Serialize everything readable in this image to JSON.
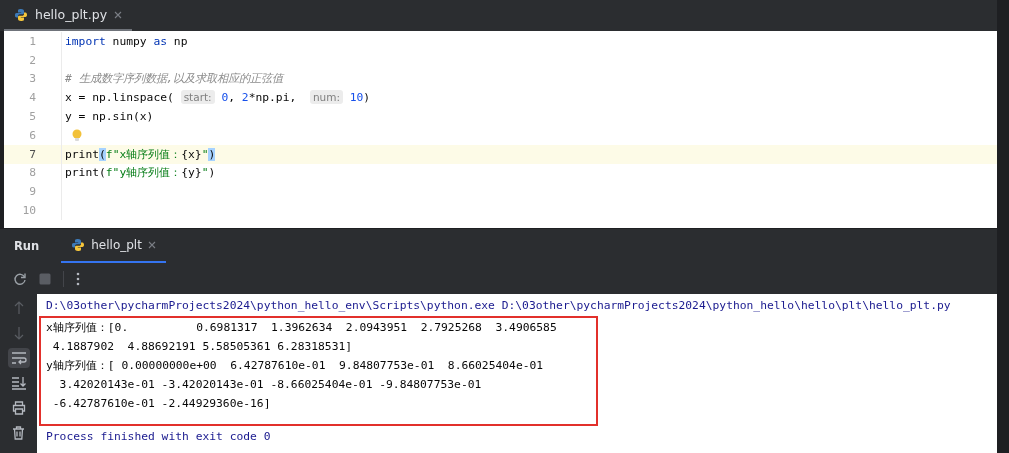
{
  "editor_tab": {
    "label": "hello_plt.py",
    "selected": true
  },
  "code_lines": [
    {
      "number": "1",
      "current": false,
      "bulb": false,
      "tokens": [
        {
          "kind": "keyword",
          "text": "import"
        },
        {
          "kind": "plain",
          "text": " numpy "
        },
        {
          "kind": "keyword",
          "text": "as"
        },
        {
          "kind": "plain",
          "text": " np"
        }
      ]
    },
    {
      "number": "2",
      "current": false,
      "bulb": false
    },
    {
      "number": "3",
      "current": false,
      "bulb": false,
      "tokens": [
        {
          "kind": "comment",
          "text": "# 生成数字序列数据,以及求取相应的正弦值"
        }
      ]
    },
    {
      "number": "4",
      "current": false,
      "bulb": false,
      "tokens": [
        {
          "kind": "plain",
          "text": "x = np.linspace( "
        },
        {
          "kind": "hint",
          "text": "start:"
        },
        {
          "kind": "number",
          "text": " 0"
        },
        {
          "kind": "plain",
          "text": ", "
        },
        {
          "kind": "number",
          "text": "2"
        },
        {
          "kind": "plain",
          "text": "*np.pi,  "
        },
        {
          "kind": "hint",
          "text": "num:"
        },
        {
          "kind": "number",
          "text": " 10"
        },
        {
          "kind": "plain",
          "text": ")"
        }
      ]
    },
    {
      "number": "5",
      "current": false,
      "bulb": false,
      "tokens": [
        {
          "kind": "plain",
          "text": "y = np.sin(x)"
        }
      ]
    },
    {
      "number": "6",
      "current": false,
      "bulb": true
    },
    {
      "number": "7",
      "current": true,
      "bulb": false,
      "tokens": [
        {
          "kind": "plain",
          "text": "print"
        },
        {
          "kind": "bracket-match",
          "text": "("
        },
        {
          "kind": "string",
          "text": "f\"x轴序列值："
        },
        {
          "kind": "plain",
          "text": "{x}"
        },
        {
          "kind": "string",
          "text": "\""
        },
        {
          "kind": "bracket-match",
          "text": ")"
        }
      ]
    },
    {
      "number": "8",
      "current": false,
      "bulb": false,
      "tokens": [
        {
          "kind": "plain",
          "text": "print("
        },
        {
          "kind": "string",
          "text": "f\"y轴序列值："
        },
        {
          "kind": "plain",
          "text": "{y}"
        },
        {
          "kind": "string",
          "text": "\""
        },
        {
          "kind": "plain",
          "text": ")"
        }
      ]
    },
    {
      "number": "9",
      "current": false,
      "bulb": false
    },
    {
      "number": "10",
      "current": false,
      "bulb": false
    }
  ],
  "run_panel": {
    "title": "Run",
    "tabs": [
      {
        "label": "hello_plt",
        "selected": true
      }
    ],
    "toolbar": [
      {
        "kind": "rerun"
      },
      {
        "kind": "stop"
      },
      {
        "kind": "more"
      }
    ],
    "side_tools": [
      {
        "kind": "up",
        "disabled": true,
        "on": false
      },
      {
        "kind": "down",
        "disabled": true,
        "on": false
      },
      {
        "kind": "wrap",
        "disabled": false,
        "on": true
      },
      {
        "kind": "scroll-end",
        "disabled": false,
        "on": false
      },
      {
        "kind": "print",
        "disabled": false,
        "on": false
      },
      {
        "kind": "trash",
        "disabled": false,
        "on": false
      }
    ]
  },
  "console": {
    "command": "D:\\03other\\pycharmProjects2024\\python_hello_env\\Scripts\\python.exe D:\\03other\\pycharmProjects2024\\python_hello\\hello\\plt\\hello_plt.py",
    "output": [
      "x轴序列值：[0.          0.6981317  1.3962634  2.0943951  2.7925268  3.4906585",
      " 4.1887902  4.88692191 5.58505361 6.28318531]",
      "y轴序列值：[ 0.00000000e+00  6.42787610e-01  9.84807753e-01  8.66025404e-01",
      "  3.42020143e-01 -3.42020143e-01 -8.66025404e-01 -9.84807753e-01",
      " -6.42787610e-01 -2.44929360e-16]"
    ],
    "exit": "Process finished with exit code 0"
  }
}
